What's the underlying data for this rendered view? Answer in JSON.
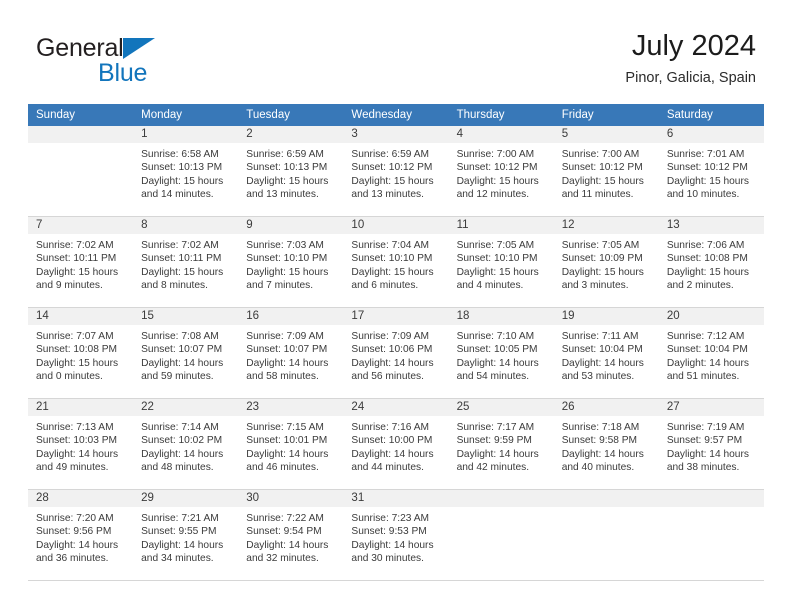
{
  "brand": {
    "name_part1": "General",
    "name_part2": "Blue",
    "triangle_icon": "triangle-icon",
    "accent_color": "#1275bc"
  },
  "header": {
    "title": "July 2024",
    "location": "Pinor, Galicia, Spain"
  },
  "calendar": {
    "header_bg": "#3878b8",
    "daynum_bg": "#f1f1f1",
    "weekdays": [
      "Sunday",
      "Monday",
      "Tuesday",
      "Wednesday",
      "Thursday",
      "Friday",
      "Saturday"
    ],
    "weeks": [
      [
        {
          "day": "",
          "sunrise": "",
          "sunset": "",
          "daylight1": "",
          "daylight2": ""
        },
        {
          "day": "1",
          "sunrise": "Sunrise: 6:58 AM",
          "sunset": "Sunset: 10:13 PM",
          "daylight1": "Daylight: 15 hours",
          "daylight2": "and 14 minutes."
        },
        {
          "day": "2",
          "sunrise": "Sunrise: 6:59 AM",
          "sunset": "Sunset: 10:13 PM",
          "daylight1": "Daylight: 15 hours",
          "daylight2": "and 13 minutes."
        },
        {
          "day": "3",
          "sunrise": "Sunrise: 6:59 AM",
          "sunset": "Sunset: 10:12 PM",
          "daylight1": "Daylight: 15 hours",
          "daylight2": "and 13 minutes."
        },
        {
          "day": "4",
          "sunrise": "Sunrise: 7:00 AM",
          "sunset": "Sunset: 10:12 PM",
          "daylight1": "Daylight: 15 hours",
          "daylight2": "and 12 minutes."
        },
        {
          "day": "5",
          "sunrise": "Sunrise: 7:00 AM",
          "sunset": "Sunset: 10:12 PM",
          "daylight1": "Daylight: 15 hours",
          "daylight2": "and 11 minutes."
        },
        {
          "day": "6",
          "sunrise": "Sunrise: 7:01 AM",
          "sunset": "Sunset: 10:12 PM",
          "daylight1": "Daylight: 15 hours",
          "daylight2": "and 10 minutes."
        }
      ],
      [
        {
          "day": "7",
          "sunrise": "Sunrise: 7:02 AM",
          "sunset": "Sunset: 10:11 PM",
          "daylight1": "Daylight: 15 hours",
          "daylight2": "and 9 minutes."
        },
        {
          "day": "8",
          "sunrise": "Sunrise: 7:02 AM",
          "sunset": "Sunset: 10:11 PM",
          "daylight1": "Daylight: 15 hours",
          "daylight2": "and 8 minutes."
        },
        {
          "day": "9",
          "sunrise": "Sunrise: 7:03 AM",
          "sunset": "Sunset: 10:10 PM",
          "daylight1": "Daylight: 15 hours",
          "daylight2": "and 7 minutes."
        },
        {
          "day": "10",
          "sunrise": "Sunrise: 7:04 AM",
          "sunset": "Sunset: 10:10 PM",
          "daylight1": "Daylight: 15 hours",
          "daylight2": "and 6 minutes."
        },
        {
          "day": "11",
          "sunrise": "Sunrise: 7:05 AM",
          "sunset": "Sunset: 10:10 PM",
          "daylight1": "Daylight: 15 hours",
          "daylight2": "and 4 minutes."
        },
        {
          "day": "12",
          "sunrise": "Sunrise: 7:05 AM",
          "sunset": "Sunset: 10:09 PM",
          "daylight1": "Daylight: 15 hours",
          "daylight2": "and 3 minutes."
        },
        {
          "day": "13",
          "sunrise": "Sunrise: 7:06 AM",
          "sunset": "Sunset: 10:08 PM",
          "daylight1": "Daylight: 15 hours",
          "daylight2": "and 2 minutes."
        }
      ],
      [
        {
          "day": "14",
          "sunrise": "Sunrise: 7:07 AM",
          "sunset": "Sunset: 10:08 PM",
          "daylight1": "Daylight: 15 hours",
          "daylight2": "and 0 minutes."
        },
        {
          "day": "15",
          "sunrise": "Sunrise: 7:08 AM",
          "sunset": "Sunset: 10:07 PM",
          "daylight1": "Daylight: 14 hours",
          "daylight2": "and 59 minutes."
        },
        {
          "day": "16",
          "sunrise": "Sunrise: 7:09 AM",
          "sunset": "Sunset: 10:07 PM",
          "daylight1": "Daylight: 14 hours",
          "daylight2": "and 58 minutes."
        },
        {
          "day": "17",
          "sunrise": "Sunrise: 7:09 AM",
          "sunset": "Sunset: 10:06 PM",
          "daylight1": "Daylight: 14 hours",
          "daylight2": "and 56 minutes."
        },
        {
          "day": "18",
          "sunrise": "Sunrise: 7:10 AM",
          "sunset": "Sunset: 10:05 PM",
          "daylight1": "Daylight: 14 hours",
          "daylight2": "and 54 minutes."
        },
        {
          "day": "19",
          "sunrise": "Sunrise: 7:11 AM",
          "sunset": "Sunset: 10:04 PM",
          "daylight1": "Daylight: 14 hours",
          "daylight2": "and 53 minutes."
        },
        {
          "day": "20",
          "sunrise": "Sunrise: 7:12 AM",
          "sunset": "Sunset: 10:04 PM",
          "daylight1": "Daylight: 14 hours",
          "daylight2": "and 51 minutes."
        }
      ],
      [
        {
          "day": "21",
          "sunrise": "Sunrise: 7:13 AM",
          "sunset": "Sunset: 10:03 PM",
          "daylight1": "Daylight: 14 hours",
          "daylight2": "and 49 minutes."
        },
        {
          "day": "22",
          "sunrise": "Sunrise: 7:14 AM",
          "sunset": "Sunset: 10:02 PM",
          "daylight1": "Daylight: 14 hours",
          "daylight2": "and 48 minutes."
        },
        {
          "day": "23",
          "sunrise": "Sunrise: 7:15 AM",
          "sunset": "Sunset: 10:01 PM",
          "daylight1": "Daylight: 14 hours",
          "daylight2": "and 46 minutes."
        },
        {
          "day": "24",
          "sunrise": "Sunrise: 7:16 AM",
          "sunset": "Sunset: 10:00 PM",
          "daylight1": "Daylight: 14 hours",
          "daylight2": "and 44 minutes."
        },
        {
          "day": "25",
          "sunrise": "Sunrise: 7:17 AM",
          "sunset": "Sunset: 9:59 PM",
          "daylight1": "Daylight: 14 hours",
          "daylight2": "and 42 minutes."
        },
        {
          "day": "26",
          "sunrise": "Sunrise: 7:18 AM",
          "sunset": "Sunset: 9:58 PM",
          "daylight1": "Daylight: 14 hours",
          "daylight2": "and 40 minutes."
        },
        {
          "day": "27",
          "sunrise": "Sunrise: 7:19 AM",
          "sunset": "Sunset: 9:57 PM",
          "daylight1": "Daylight: 14 hours",
          "daylight2": "and 38 minutes."
        }
      ],
      [
        {
          "day": "28",
          "sunrise": "Sunrise: 7:20 AM",
          "sunset": "Sunset: 9:56 PM",
          "daylight1": "Daylight: 14 hours",
          "daylight2": "and 36 minutes."
        },
        {
          "day": "29",
          "sunrise": "Sunrise: 7:21 AM",
          "sunset": "Sunset: 9:55 PM",
          "daylight1": "Daylight: 14 hours",
          "daylight2": "and 34 minutes."
        },
        {
          "day": "30",
          "sunrise": "Sunrise: 7:22 AM",
          "sunset": "Sunset: 9:54 PM",
          "daylight1": "Daylight: 14 hours",
          "daylight2": "and 32 minutes."
        },
        {
          "day": "31",
          "sunrise": "Sunrise: 7:23 AM",
          "sunset": "Sunset: 9:53 PM",
          "daylight1": "Daylight: 14 hours",
          "daylight2": "and 30 minutes."
        },
        {
          "day": "",
          "sunrise": "",
          "sunset": "",
          "daylight1": "",
          "daylight2": ""
        },
        {
          "day": "",
          "sunrise": "",
          "sunset": "",
          "daylight1": "",
          "daylight2": ""
        },
        {
          "day": "",
          "sunrise": "",
          "sunset": "",
          "daylight1": "",
          "daylight2": ""
        }
      ]
    ]
  }
}
